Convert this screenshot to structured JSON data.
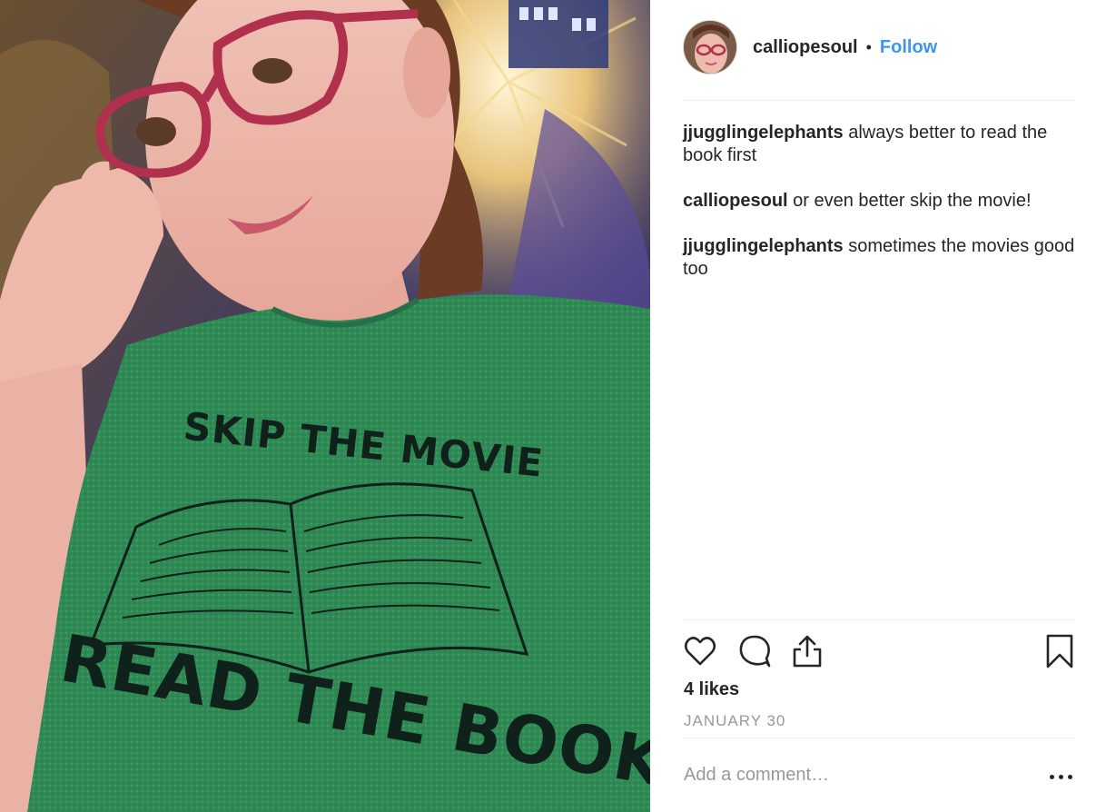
{
  "post": {
    "username": "calliopesoul",
    "separator": "•",
    "follow_label": "Follow",
    "photo": {
      "shirt_top_text": "SKIP THE MOVIE",
      "shirt_bottom_text": "READ THE BOOK"
    },
    "comments": [
      {
        "author": "jjugglingelephants",
        "text": "always better to read the book first"
      },
      {
        "author": "calliopesoul",
        "text": "or even better skip the movie!"
      },
      {
        "author": "jjugglingelephants",
        "text": "sometimes the movies good too"
      }
    ],
    "actions": {
      "like_icon": "heart-icon",
      "comment_icon": "speech-bubble-icon",
      "share_icon": "share-icon",
      "save_icon": "bookmark-icon"
    },
    "likes_label": "4 likes",
    "date_label": "JANUARY 30",
    "comment_placeholder": "Add a comment…",
    "more_icon": "ellipsis-icon"
  },
  "colors": {
    "follow_blue": "#3897f0",
    "text_primary": "#262626",
    "text_secondary": "#999999",
    "shirt_green": "#2f8a56",
    "divider": "#efefef"
  }
}
